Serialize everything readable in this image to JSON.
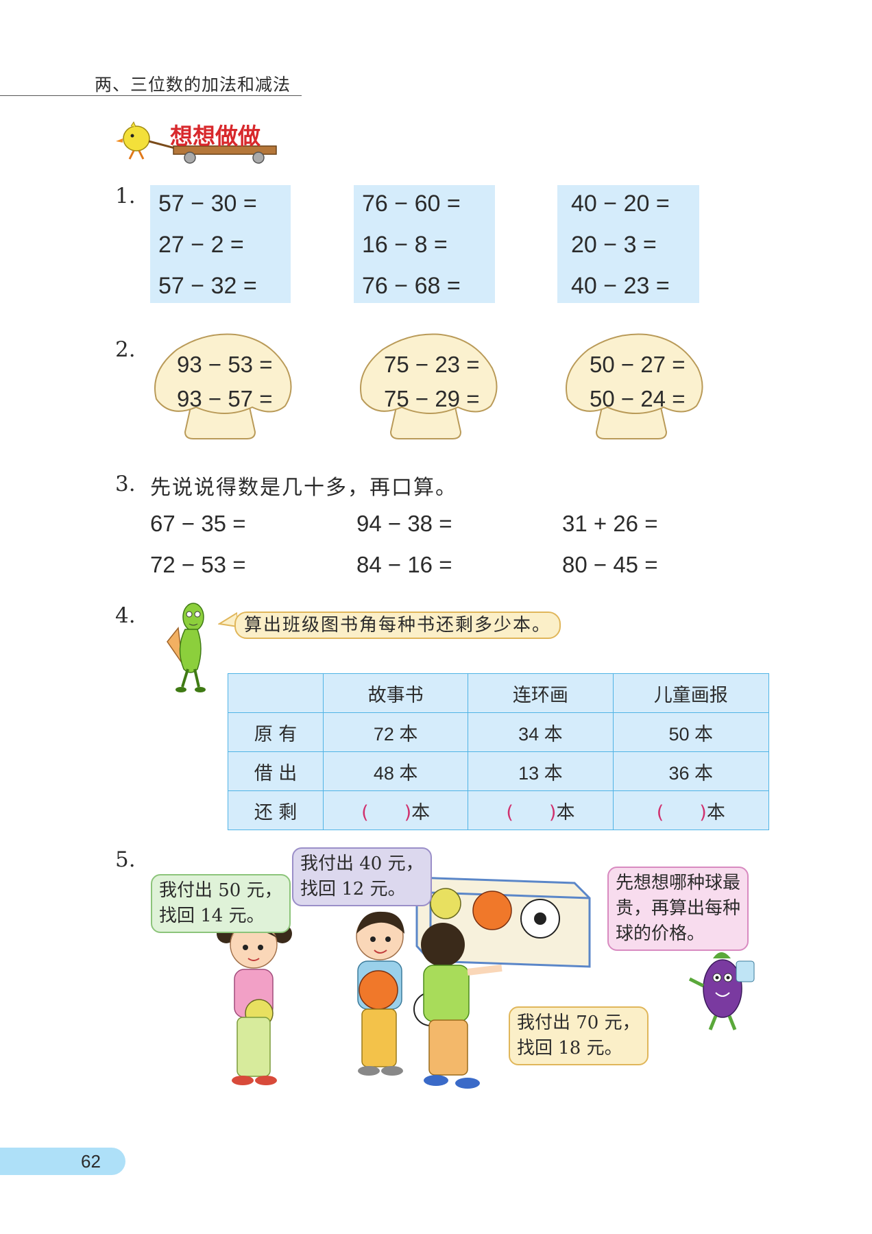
{
  "header": {
    "chapter_title": "两、三位数的加法和减法"
  },
  "section": {
    "title": "想想做做"
  },
  "q1": {
    "number": "1.",
    "groups": [
      [
        "57 − 30 =",
        "27 − 2 =",
        "57 − 32 ="
      ],
      [
        "76 − 60 =",
        "16 − 8 =",
        "76 − 68 ="
      ],
      [
        "40 − 20 =",
        "20 − 3 =",
        "40 − 23 ="
      ]
    ]
  },
  "q2": {
    "number": "2.",
    "mushrooms": [
      [
        "93 − 53 =",
        "93 − 57 ="
      ],
      [
        "75 − 23 =",
        "75 − 29 ="
      ],
      [
        "50 − 27 =",
        "50 − 24 ="
      ]
    ]
  },
  "q3": {
    "number": "3.",
    "instruction": "先说说得数是几十多，再口算。",
    "rows": [
      [
        "67 − 35 =",
        "94 − 38 =",
        "31 + 26 ="
      ],
      [
        "72 − 53 =",
        "84 − 16 =",
        "80 − 45 ="
      ]
    ]
  },
  "q4": {
    "number": "4.",
    "speech": "算出班级图书角每种书还剩多少本。",
    "table": {
      "headers": [
        "",
        "故事书",
        "连环画",
        "儿童画报"
      ],
      "rows": [
        {
          "label": "原 有",
          "values": [
            "72 本",
            "34 本",
            "50 本"
          ]
        },
        {
          "label": "借 出",
          "values": [
            "48 本",
            "13 本",
            "36 本"
          ]
        }
      ],
      "remain_label": "还 剩",
      "open_paren": "(",
      "close_paren": ")",
      "unit": "本"
    }
  },
  "q5": {
    "number": "5.",
    "bubbles": {
      "girl": [
        "我付出 50 元，",
        "找回 14 元。"
      ],
      "boy1": [
        "我付出 40 元，",
        "找回 12 元。"
      ],
      "boy2": [
        "我付出 70 元，",
        "找回 18 元。"
      ],
      "eggplant": [
        "先想想哪种球最",
        "贵，再算出每种",
        "球的价格。"
      ]
    }
  },
  "footer": {
    "page_number": "62"
  },
  "colors": {
    "title_red": "#d8282c",
    "box_blue": "#d5ecfb",
    "table_border": "#4fb3e5",
    "paren_pink": "#d0316d"
  }
}
